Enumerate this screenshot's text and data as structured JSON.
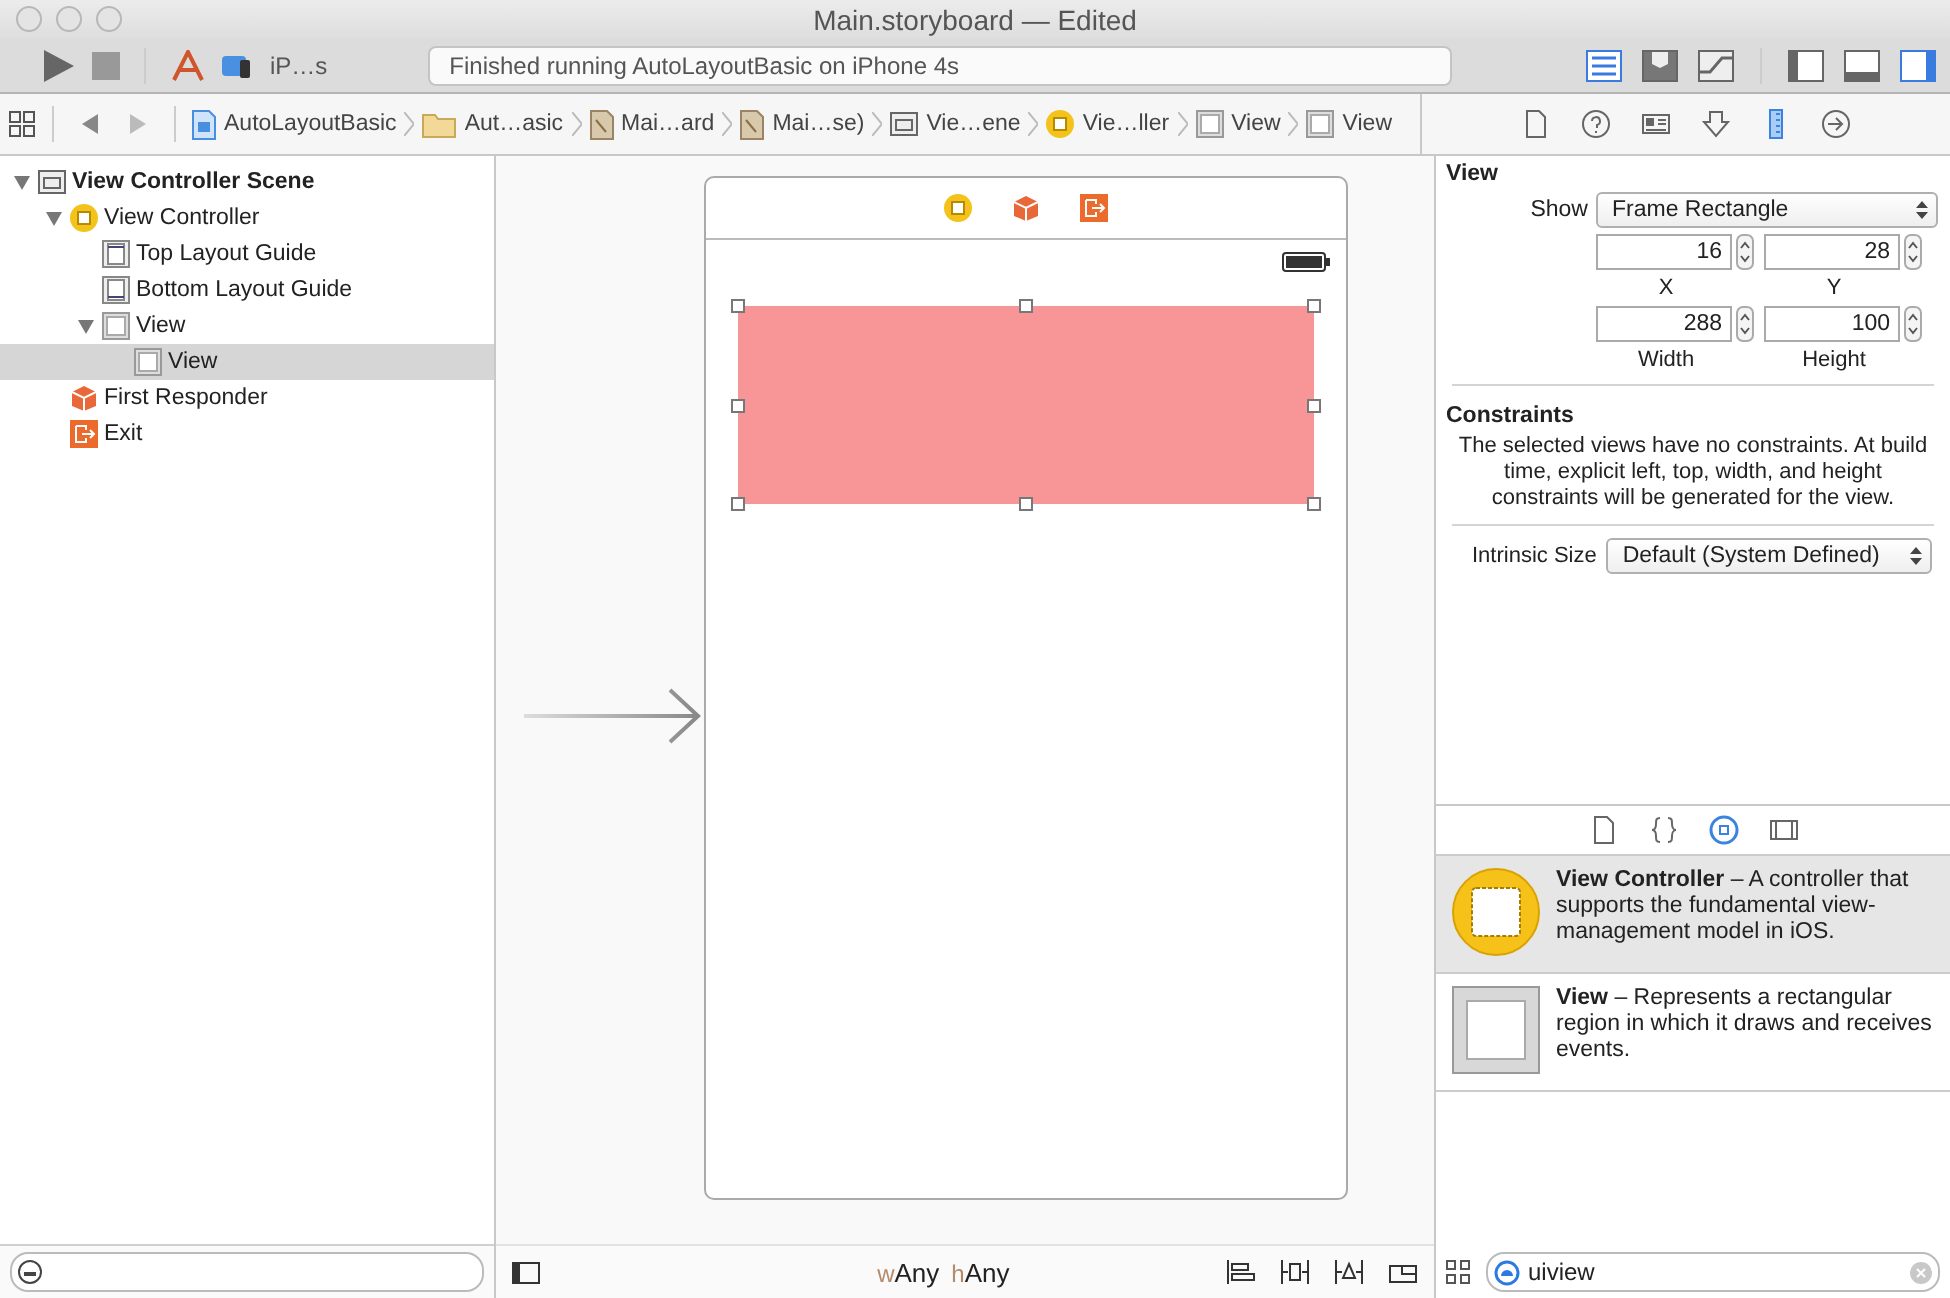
{
  "window": {
    "title": "Main.storyboard — Edited"
  },
  "toolbar": {
    "scheme": "iP…s",
    "status": "Finished running AutoLayoutBasic on iPhone 4s",
    "editor_modes": [
      {
        "kind": "standard",
        "selected": true
      },
      {
        "kind": "assistant",
        "selected": false
      },
      {
        "kind": "version",
        "selected": false
      }
    ],
    "panels": [
      {
        "kind": "left",
        "selected": false
      },
      {
        "kind": "bottom",
        "selected": false
      },
      {
        "kind": "right",
        "selected": true
      }
    ]
  },
  "breadcrumbs": [
    {
      "label": "AutoLayoutBasic",
      "kind": "project"
    },
    {
      "label": "Aut…asic",
      "kind": "folder"
    },
    {
      "label": "Mai…ard",
      "kind": "file"
    },
    {
      "label": "Mai…se)",
      "kind": "file"
    },
    {
      "label": "Vie…ene",
      "kind": "scene"
    },
    {
      "label": "Vie…ller",
      "kind": "controller"
    },
    {
      "label": "View",
      "kind": "view"
    },
    {
      "label": "View",
      "kind": "view"
    }
  ],
  "outline": [
    {
      "label": "View Controller Scene",
      "kind": "scene",
      "expanded": true,
      "selected": false,
      "children": [
        {
          "label": "View Controller",
          "kind": "controller",
          "expanded": true,
          "selected": false,
          "children": [
            {
              "label": "Top Layout Guide",
              "kind": "top-guide",
              "selected": false
            },
            {
              "label": "Bottom Layout Guide",
              "kind": "bottom-guide",
              "selected": false
            },
            {
              "label": "View",
              "kind": "view",
              "expanded": true,
              "selected": false,
              "children": [
                {
                  "label": "View",
                  "kind": "view",
                  "selected": true
                }
              ]
            }
          ]
        },
        {
          "label": "First Responder",
          "kind": "responder",
          "selected": false
        },
        {
          "label": "Exit",
          "kind": "exit",
          "selected": false
        }
      ]
    }
  ],
  "canvas": {
    "size_class": [
      {
        "prefix": "w",
        "value": "Any"
      },
      {
        "prefix": "h",
        "value": "Any"
      }
    ]
  },
  "inspector": {
    "tabs": [
      {
        "kind": "file",
        "selected": false
      },
      {
        "kind": "help",
        "selected": false
      },
      {
        "kind": "identity",
        "selected": false
      },
      {
        "kind": "attributes",
        "selected": false
      },
      {
        "kind": "size",
        "selected": true
      },
      {
        "kind": "connections",
        "selected": false
      }
    ],
    "section": "View",
    "show_label": "Show",
    "show_value": "Frame Rectangle",
    "fields": [
      {
        "value": "16",
        "label": "X"
      },
      {
        "value": "28",
        "label": "Y"
      },
      {
        "value": "288",
        "label": "Width"
      },
      {
        "value": "100",
        "label": "Height"
      }
    ],
    "constraints_title": "Constraints",
    "constraints_text": "The selected views have no constraints. At build time, explicit left, top, width, and height constraints will be generated for the view.",
    "intrinsic_label": "Intrinsic Size",
    "intrinsic_value": "Default (System Defined)"
  },
  "library": {
    "tabs": [
      {
        "kind": "file",
        "selected": false
      },
      {
        "kind": "code",
        "selected": false
      },
      {
        "kind": "object",
        "selected": true
      },
      {
        "kind": "media",
        "selected": false
      }
    ],
    "items": [
      {
        "kind": "controller",
        "title": "View Controller",
        "description": " – A controller that supports the fundamental view-management model in iOS.",
        "selected": true
      },
      {
        "kind": "view",
        "title": "View",
        "description": " – Represents a rectangular region in which it draws and receives events.",
        "selected": false
      }
    ],
    "search": "uiview"
  }
}
